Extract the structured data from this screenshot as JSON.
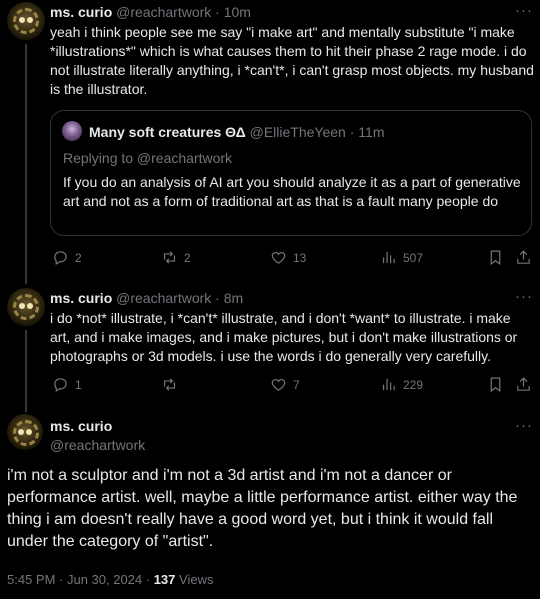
{
  "tweets": [
    {
      "name": "ms. curio",
      "handle": "@reachartwork",
      "time": "10m",
      "text": "yeah i think people see me say \"i make art\" and mentally substitute \"i make *illustrations*\" which is what causes them to hit their phase 2 rage mode. i do not illustrate literally anything, i *can't*, i can't grasp most objects. my husband is the illustrator.",
      "quote": {
        "name": "Many soft creatures ΘΔ",
        "handle": "@EllieTheYeen",
        "time": "11m",
        "replying": "Replying to @reachartwork",
        "text": "If you do an analysis of AI art you should analyze it as a part of generative art and not as a form of traditional art as that is a fault many people do"
      },
      "replies": "2",
      "reposts": "2",
      "likes": "13",
      "views": "507"
    },
    {
      "name": "ms. curio",
      "handle": "@reachartwork",
      "time": "8m",
      "text": "i do *not* illustrate, i *can't* illustrate, and i don't *want* to illustrate. i make art, and i make images, and i make pictures, but i don't make illustrations or photographs or 3d models. i use the words i do generally very carefully.",
      "replies": "1",
      "reposts": "",
      "likes": "7",
      "views": "229"
    }
  ],
  "main": {
    "name": "ms. curio",
    "handle": "@reachartwork",
    "text": "i'm not a sculptor and i'm not a 3d artist and i'm not a dancer or performance artist. well, maybe a little performance artist. either way the thing i am doesn't really have a good word yet, but i think it would fall under the category of \"artist\".",
    "timestamp": "5:45 PM · Jun 30, 2024 · ",
    "views_count": "137",
    "views_label": "Views"
  },
  "more_glyph": "···",
  "separator": "·",
  "icons": [
    "reply-icon",
    "repost-icon",
    "like-icon",
    "views-icon",
    "bookmark-icon",
    "share-icon",
    "more-icon"
  ],
  "colors": {
    "background": "#000000",
    "text": "#e7e9ea",
    "muted": "#71767b",
    "border": "#2f3336"
  }
}
